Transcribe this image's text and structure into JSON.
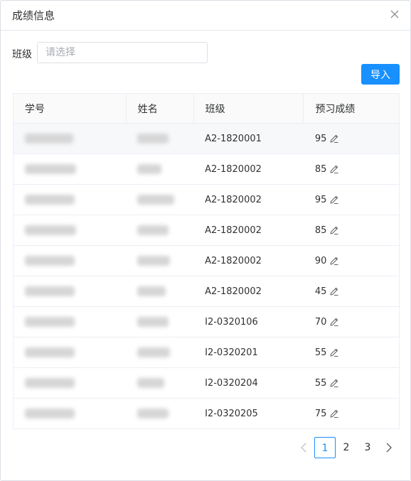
{
  "dialog": {
    "title": "成绩信息"
  },
  "filter": {
    "label": "班级",
    "placeholder": "请选择"
  },
  "import_button": "导入",
  "table": {
    "columns": [
      "学号",
      "姓名",
      "班级",
      "预习成绩"
    ],
    "rows": [
      {
        "class": "A2-1820001",
        "score": "95"
      },
      {
        "class": "A2-1820002",
        "score": "85"
      },
      {
        "class": "A2-1820002",
        "score": "95"
      },
      {
        "class": "A2-1820002",
        "score": "85"
      },
      {
        "class": "A2-1820002",
        "score": "90"
      },
      {
        "class": "A2-1820002",
        "score": "45"
      },
      {
        "class": "I2-0320106",
        "score": "70"
      },
      {
        "class": "I2-0320201",
        "score": "55"
      },
      {
        "class": "I2-0320204",
        "score": "55"
      },
      {
        "class": "I2-0320205",
        "score": "75"
      }
    ]
  },
  "pagination": {
    "pages": [
      "1",
      "2",
      "3"
    ],
    "current": "1"
  },
  "icons": {
    "close": "close-icon",
    "edit": "edit-icon",
    "prev": "chevron-left-icon",
    "next": "chevron-right-icon"
  },
  "colors": {
    "primary": "#1890ff",
    "border": "#ebeef5"
  }
}
